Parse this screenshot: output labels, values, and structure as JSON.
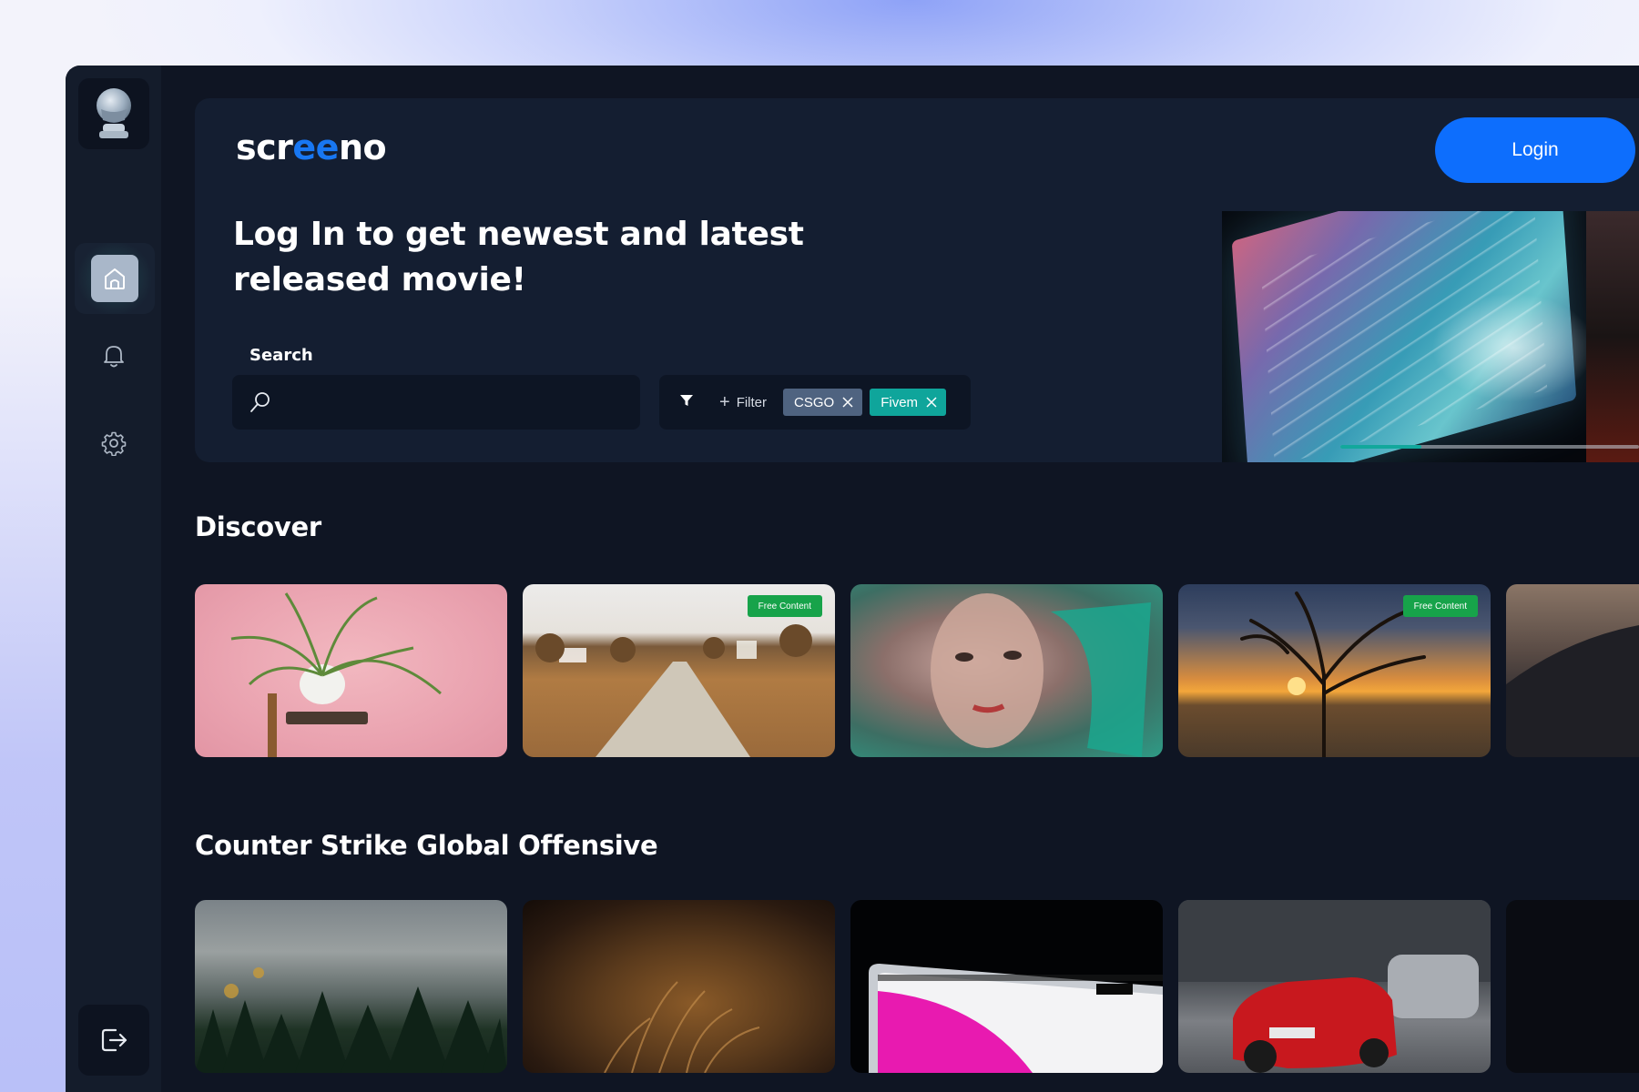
{
  "app": {
    "logo": {
      "part1": "scr",
      "part2": "ee",
      "part3": "no"
    },
    "accent_color": "#1877f2"
  },
  "sidebar": {
    "items": [
      {
        "name": "home",
        "icon": "home-icon",
        "active": true
      },
      {
        "name": "notifications",
        "icon": "bell-icon",
        "active": false
      },
      {
        "name": "settings",
        "icon": "gear-icon",
        "active": false
      }
    ],
    "logout_icon": "logout-icon"
  },
  "header": {
    "login_label": "Login",
    "headline": "Log In to get newest and latest released movie!",
    "search_label": "Search",
    "search_placeholder": "",
    "filter_label": "Filter",
    "filter_chips": [
      {
        "label": "CSGO",
        "color": "#4f6380"
      },
      {
        "label": "Fivem",
        "color": "#0fa59b"
      }
    ],
    "carousel_progress": 0.27
  },
  "sections": [
    {
      "title": "Discover",
      "cards": [
        {
          "image": "potted-plant-pink-background",
          "badge": ""
        },
        {
          "image": "dirt-road-autumn-fields",
          "badge": "Free Content"
        },
        {
          "image": "woman-green-veil",
          "badge": ""
        },
        {
          "image": "sunset-tree-savanna",
          "badge": "Free Content"
        },
        {
          "image": "dark-hills",
          "badge": ""
        }
      ]
    },
    {
      "title": "Counter Strike Global Offensive",
      "cards": [
        {
          "image": "mountain-forest",
          "badge": ""
        },
        {
          "image": "dry-grass-closeup",
          "badge": ""
        },
        {
          "image": "laptop-screen-magenta",
          "badge": ""
        },
        {
          "image": "red-sports-car-street",
          "badge": ""
        },
        {
          "image": "dark",
          "badge": ""
        }
      ]
    }
  ],
  "badge_color": "#17a34a"
}
